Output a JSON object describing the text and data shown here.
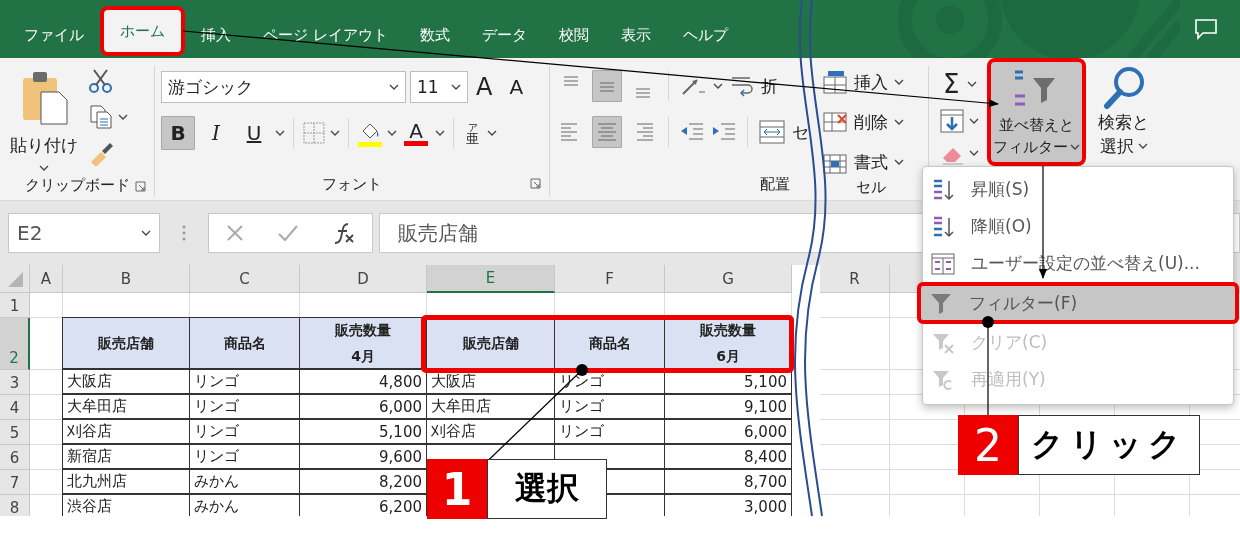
{
  "tabs": [
    {
      "label": "ファイル",
      "selected": false,
      "highlighted": false
    },
    {
      "label": "ホーム",
      "selected": true,
      "highlighted": true
    },
    {
      "label": "挿入",
      "selected": false,
      "highlighted": false
    },
    {
      "label": "ページ レイアウト",
      "selected": false,
      "highlighted": false
    },
    {
      "label": "数式",
      "selected": false,
      "highlighted": false
    },
    {
      "label": "データ",
      "selected": false,
      "highlighted": false
    },
    {
      "label": "校閲",
      "selected": false,
      "highlighted": false
    },
    {
      "label": "表示",
      "selected": false,
      "highlighted": false
    },
    {
      "label": "ヘルプ",
      "selected": false,
      "highlighted": false
    }
  ],
  "ribbon": {
    "clipboard": {
      "paste": "貼り付け",
      "label": "クリップボード"
    },
    "font": {
      "name": "游ゴシック",
      "size": "11",
      "grow": "A",
      "shrink": "A",
      "font_color": "A",
      "phonetic": [
        "ア",
        "亜"
      ],
      "label": "フォント",
      "styles": [
        {
          "kind": "bold",
          "text": "B",
          "on": true
        },
        {
          "kind": "italic",
          "text": "I",
          "on": false
        },
        {
          "kind": "underline",
          "text": "U",
          "on": false
        }
      ]
    },
    "alignment": {
      "label": "配置",
      "wrap_text": "折",
      "merge": "セ",
      "vertical": [
        {
          "kind": "top",
          "on": false
        },
        {
          "kind": "middle",
          "on": true
        },
        {
          "kind": "bottom",
          "on": false
        }
      ],
      "horizontal": [
        {
          "kind": "left",
          "on": false
        },
        {
          "kind": "center",
          "on": true
        },
        {
          "kind": "right",
          "on": false
        }
      ]
    },
    "cells": {
      "label": "セル",
      "items": [
        {
          "kind": "insert",
          "label": "挿入"
        },
        {
          "kind": "delete",
          "label": "削除"
        },
        {
          "kind": "format",
          "label": "書式"
        }
      ]
    },
    "editing": {
      "sum": "Σ",
      "sort_filter": {
        "lines": [
          "並べ替えと",
          "フィルター"
        ],
        "highlighted": true
      },
      "find": {
        "lines": [
          "検索と",
          "選択"
        ]
      }
    }
  },
  "formula_bar": {
    "name_box": "E2",
    "value": "販売店舗"
  },
  "sheet": {
    "columns": [
      {
        "label": "A",
        "kind": "empty",
        "selected": false,
        "highlighted": false
      },
      {
        "label": "B",
        "kind": "text",
        "selected": false,
        "highlighted": false
      },
      {
        "label": "C",
        "kind": "text",
        "selected": false,
        "highlighted": false
      },
      {
        "label": "D",
        "kind": "number",
        "selected": false,
        "highlighted": false
      },
      {
        "label": "E",
        "kind": "text",
        "selected": true,
        "highlighted": true
      },
      {
        "label": "F",
        "kind": "text",
        "selected": false,
        "highlighted": true
      },
      {
        "label": "G",
        "kind": "number",
        "selected": false,
        "highlighted": true
      }
    ],
    "columns_after_break": [
      "R"
    ],
    "rows": [
      {
        "header": "1",
        "kind": "blank",
        "selected": false,
        "cells": {}
      },
      {
        "header": "2",
        "kind": "header",
        "selected": true,
        "cells": {
          "B": "販売店舗",
          "C": "商品名",
          "D": "販売数量\n4月",
          "E": "販売店舗",
          "F": "商品名",
          "G": "販売数量\n6月"
        }
      },
      {
        "header": "3",
        "kind": "data",
        "selected": false,
        "cells": {
          "B": "大阪店",
          "C": "リンゴ",
          "D": "4,800",
          "E": "大阪店",
          "F": "リンゴ",
          "G": "5,100"
        }
      },
      {
        "header": "4",
        "kind": "data",
        "selected": false,
        "cells": {
          "B": "大牟田店",
          "C": "リンゴ",
          "D": "6,000",
          "E": "大牟田店",
          "F": "リンゴ",
          "G": "9,100"
        }
      },
      {
        "header": "5",
        "kind": "data",
        "selected": false,
        "cells": {
          "B": "刈谷店",
          "C": "リンゴ",
          "D": "5,100",
          "E": "刈谷店",
          "F": "リンゴ",
          "G": "6,000"
        }
      },
      {
        "header": "6",
        "kind": "data",
        "selected": false,
        "cells": {
          "B": "新宿店",
          "C": "リンゴ",
          "D": "9,600",
          "G": "8,400"
        }
      },
      {
        "header": "7",
        "kind": "data",
        "selected": false,
        "cells": {
          "B": "北九州店",
          "C": "みかん",
          "D": "8,200",
          "G": "8,700"
        }
      },
      {
        "header": "8",
        "kind": "data",
        "selected": false,
        "cells": {
          "B": "渋谷店",
          "C": "みかん",
          "D": "6,200",
          "G": "3,000"
        }
      }
    ]
  },
  "menu": [
    {
      "kind": "sort-asc",
      "label": "昇順(S)",
      "disabled": false,
      "highlighted": false
    },
    {
      "kind": "sort-desc",
      "label": "降順(O)",
      "disabled": false,
      "highlighted": false
    },
    {
      "kind": "custom-sort",
      "label": "ユーザー設定の並べ替え(U)...",
      "disabled": false,
      "highlighted": false
    },
    {
      "kind": "filter",
      "label": "フィルター(F)",
      "disabled": false,
      "highlighted": true
    },
    {
      "kind": "clear",
      "label": "クリア(C)",
      "disabled": true,
      "highlighted": false
    },
    {
      "kind": "reapply",
      "label": "再適用(Y)",
      "disabled": true,
      "highlighted": false
    }
  ],
  "callouts": [
    {
      "number": "1",
      "label": "選択"
    },
    {
      "number": "2",
      "label": "クリック"
    }
  ]
}
